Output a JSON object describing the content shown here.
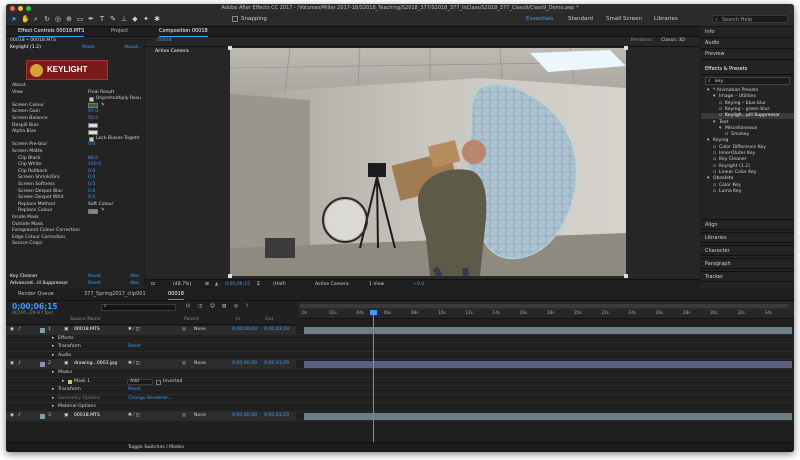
{
  "window": {
    "title": "Adobe After Effects CC 2017 - /Volumes/Miller 2017-18/S2018_Teaching/S2018_377/S2018_377_InClass/S2018_377_Class9/Class9_Demo.aep *"
  },
  "toolbar": {
    "snapping_label": "Snapping",
    "workspaces": [
      "Essentials",
      "Standard",
      "Small Screen",
      "Libraries"
    ],
    "search_placeholder": "Search Help"
  },
  "effect_controls": {
    "tab_label": "Effect Controls 00018.MTS",
    "project_tab": "Project",
    "breadcrumb": "00018 • 00018.MTS",
    "effect_name": "Keylight (1.2)",
    "reset": "Reset",
    "about_label": "About...",
    "logo_text": "KEYLIGHT",
    "rows": [
      {
        "label": "About",
        "value": ""
      },
      {
        "label": "View",
        "value": "Final Result"
      },
      {
        "label": "",
        "value": "Unpremultiply Resu"
      },
      {
        "label": "Screen Colour",
        "value": ""
      },
      {
        "label": "Screen Gain",
        "value": "97.0"
      },
      {
        "label": "Screen Balance",
        "value": "50.0"
      },
      {
        "label": "Despill Bias",
        "value": ""
      },
      {
        "label": "Alpha Bias",
        "value": ""
      },
      {
        "label": "",
        "value": "Lock Biases Togeth"
      },
      {
        "label": "Screen Pre-blur",
        "value": "0.0"
      },
      {
        "label": "Screen Matte",
        "value": ""
      },
      {
        "label": "Clip Black",
        "value": "86.0"
      },
      {
        "label": "Clip White",
        "value": "100.0"
      },
      {
        "label": "Clip Rollback",
        "value": "0.0"
      },
      {
        "label": "Screen Shrink/Gro",
        "value": "0.0"
      },
      {
        "label": "Screen Softness",
        "value": "0.5"
      },
      {
        "label": "Screen Despot Blac",
        "value": "0.0"
      },
      {
        "label": "Screen Despot Whit",
        "value": "0.0"
      },
      {
        "label": "Replace Method",
        "value": "Soft Colour"
      },
      {
        "label": "Replace Colour",
        "value": ""
      },
      {
        "label": "Inside Mask",
        "value": ""
      },
      {
        "label": "Outside Mask",
        "value": ""
      },
      {
        "label": "Foreground Colour Correction",
        "value": ""
      },
      {
        "label": "Edge Colour Correction",
        "value": ""
      },
      {
        "label": "Source Crops",
        "value": ""
      }
    ],
    "bottom_rows": [
      {
        "label": "Key Cleaner",
        "reset": "Reset",
        "about": "Abo"
      },
      {
        "label": "Advanced...ill Suppressor",
        "reset": "Reset",
        "about": "Abo"
      }
    ]
  },
  "composition": {
    "tab_label": "Composition 00018",
    "sub_tab": "00018",
    "renderer_label": "Renderer:",
    "renderer_value": "Classic 3D",
    "camera_label": "Active Camera",
    "footer": {
      "zoom": "(48.7%)",
      "timecode": "0;00;06;15",
      "resolution": "(Half)",
      "camera": "Active Camera",
      "views": "1 View",
      "exposure": "+0.0"
    }
  },
  "right_panel": {
    "sections": [
      "Info",
      "Audio",
      "Preview"
    ],
    "effects_presets": {
      "title": "Effects & Presets",
      "search_value": "key",
      "tree": [
        {
          "label": "* Animation Presets",
          "indent": 0
        },
        {
          "label": "Image – Utilities",
          "indent": 1
        },
        {
          "label": "Keying – blue blur",
          "indent": 2
        },
        {
          "label": "Keying – green blur",
          "indent": 2
        },
        {
          "label": "Keyligh...pill Suppressor",
          "indent": 2,
          "selected": true
        },
        {
          "label": "Text",
          "indent": 1
        },
        {
          "label": "Miscellaneous",
          "indent": 2
        },
        {
          "label": "Smokey",
          "indent": 3
        },
        {
          "label": "Keying",
          "indent": 0
        },
        {
          "label": "Color Difference Key",
          "indent": 1
        },
        {
          "label": "Inner/Outer Key",
          "indent": 1
        },
        {
          "label": "Key Cleaner",
          "indent": 1
        },
        {
          "label": "Keylight (1.2)",
          "indent": 1
        },
        {
          "label": "Linear Color Key",
          "indent": 1
        },
        {
          "label": "Obsolete",
          "indent": 0
        },
        {
          "label": "Color Key",
          "indent": 1
        },
        {
          "label": "Luma Key",
          "indent": 1
        }
      ]
    },
    "bottom_sections": [
      "Align",
      "Libraries",
      "Character",
      "Paragraph",
      "Tracker"
    ]
  },
  "timeline": {
    "tabs": [
      "Render Queue",
      "377_Spring2017_clip001",
      "00018"
    ],
    "timecode": "0;00;06;15",
    "frame_info": "00195 (29.97 fps)",
    "columns": {
      "source": "Source Name",
      "parent": "Parent",
      "in": "In",
      "out": "Out"
    },
    "ticks": [
      "0s",
      "02s",
      "04s",
      "06s",
      "08s",
      "10s",
      "12s",
      "14s",
      "16s",
      "18s",
      "20s",
      "22s",
      "24s",
      "26s",
      "28s",
      "30s",
      "32s",
      "34s"
    ],
    "rows": [
      {
        "num": "1",
        "name": "00018.MTS",
        "parent": "None",
        "in": "0;00;00;00",
        "out": "0;00;43;29",
        "kind": "layer",
        "bar": "teal"
      },
      {
        "name": "Effects",
        "kind": "sub"
      },
      {
        "name": "Transform",
        "value": "Reset",
        "kind": "sub"
      },
      {
        "name": "Audio",
        "kind": "sub"
      },
      {
        "num": "2",
        "name": "drawing...0003.jpg",
        "parent": "None",
        "in": "0;00;00;00",
        "out": "0;00;43;29",
        "kind": "layer",
        "bar": "purple"
      },
      {
        "name": "Masks",
        "kind": "sub"
      },
      {
        "name": "Mask 1",
        "mode": "Add",
        "inverted": "Inverted",
        "kind": "mask"
      },
      {
        "name": "Transform",
        "value": "Reset",
        "kind": "sub"
      },
      {
        "name": "Geometry Options",
        "value": "Change Renderer...",
        "kind": "sub"
      },
      {
        "name": "Material Options",
        "kind": "sub"
      },
      {
        "num": "3",
        "name": "00018.MTS",
        "parent": "None",
        "in": "0;00;00;00",
        "out": "0;00;43;29",
        "kind": "layer",
        "bar": "teal"
      }
    ],
    "footer_label": "Toggle Switches / Modes"
  },
  "colors": {
    "accent": "#3d9bff",
    "panel": "#232323",
    "logo_red": "#7a1a1a"
  }
}
